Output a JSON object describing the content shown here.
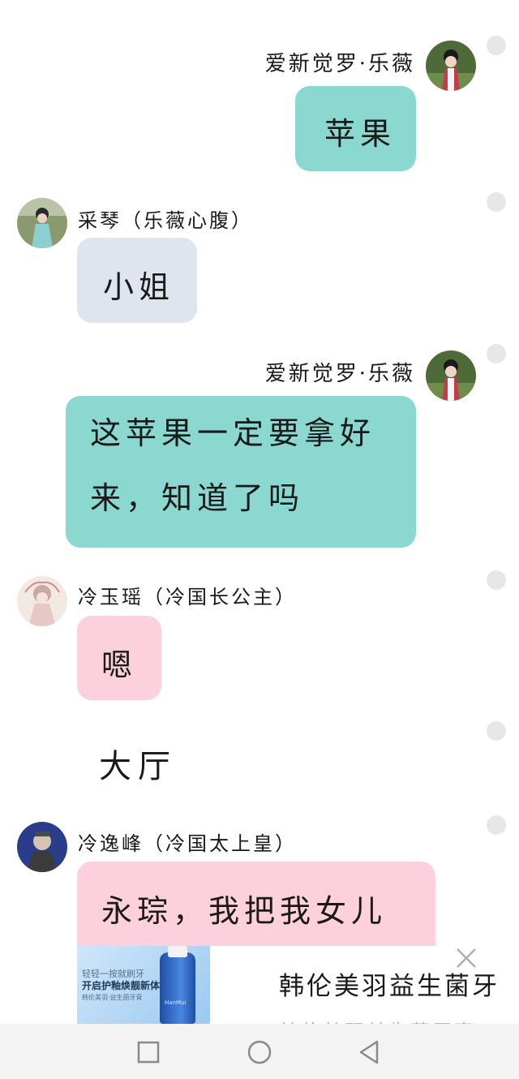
{
  "messages": [
    {
      "sender": "爱新觉罗·乐薇",
      "text": "苹果",
      "side": "right",
      "color": "teal"
    },
    {
      "sender": "采琴（乐薇心腹）",
      "text": "小姐",
      "side": "left",
      "color": "gray"
    },
    {
      "sender": "爱新觉罗·乐薇",
      "lines": [
        "这苹果一定要拿好",
        "来，知道了吗"
      ],
      "side": "right",
      "color": "teal"
    },
    {
      "sender": "冷玉瑶（冷国长公主）",
      "text": "嗯",
      "side": "left",
      "color": "pink"
    },
    {
      "narration": "大厅"
    },
    {
      "sender": "冷逸峰（冷国太上皇）",
      "text": "永琮，我把我女儿",
      "side": "left",
      "color": "pink"
    }
  ],
  "ad": {
    "title": "韩伦美羽益生菌牙",
    "subtitle": "韩伦美羽益生菌牙膏",
    "image_line1": "轻轻一按就刷牙",
    "image_line2": "开启护釉焕靓新体验",
    "image_line3": "韩伦美羽·益生菌牙膏",
    "brand": "HanMui",
    "close_icon": "close-icon"
  },
  "nav": {
    "recent_icon": "square-icon",
    "home_icon": "circle-icon",
    "back_icon": "triangle-back-icon"
  },
  "colors": {
    "teal_bubble": "#8ad8d0",
    "gray_bubble": "#dfe5ee",
    "pink_bubble": "#fcd0dc",
    "nav_bg": "#f3f3f3"
  }
}
